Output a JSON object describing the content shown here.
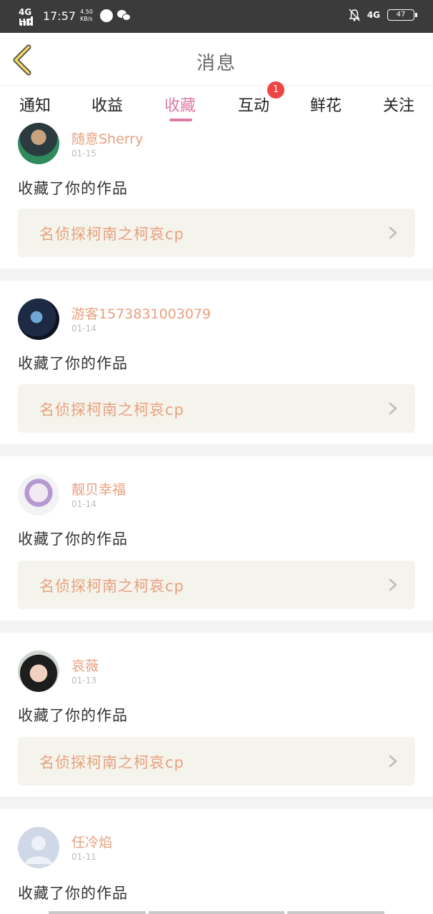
{
  "status_bar": {
    "network": "4G HD",
    "time": "17:57",
    "speed_value": "4.50",
    "speed_unit": "KB/s",
    "right_network": "4G",
    "battery": "47"
  },
  "header": {
    "title": "消息",
    "back_icon": "chevron-left-icon"
  },
  "tabs": [
    {
      "label": "通知",
      "active": false
    },
    {
      "label": "收益",
      "active": false
    },
    {
      "label": "收藏",
      "active": true
    },
    {
      "label": "互动",
      "active": false,
      "badge": "1"
    },
    {
      "label": "鲜花",
      "active": false
    },
    {
      "label": "关注",
      "active": false
    }
  ],
  "colors": {
    "accent": "#e07aa5",
    "username": "#e8a07e",
    "badge": "#ef4444",
    "work_bg": "#f5f4ec"
  },
  "notifications": [
    {
      "username": "随意Sherry",
      "date": "01-15",
      "action": "收藏了你的作品",
      "work": "名侦探柯南之柯哀cp"
    },
    {
      "username": "游客1573831003079",
      "date": "01-14",
      "action": "收藏了你的作品",
      "work": "名侦探柯南之柯哀cp"
    },
    {
      "username": "靓贝幸福",
      "date": "01-14",
      "action": "收藏了你的作品",
      "work": "名侦探柯南之柯哀cp"
    },
    {
      "username": "哀薇",
      "date": "01-13",
      "action": "收藏了你的作品",
      "work": "名侦探柯南之柯哀cp"
    },
    {
      "username": "任冷焰",
      "date": "01-11",
      "action": "收藏了你的作品",
      "work": ""
    }
  ]
}
